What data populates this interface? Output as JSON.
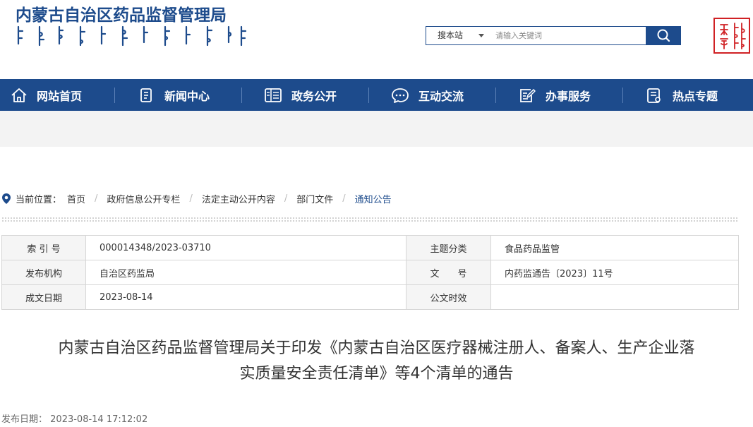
{
  "header": {
    "site_title": "内蒙古自治区药品监督管理局",
    "search": {
      "scope_label": "搜本站",
      "placeholder": "请输入关键词"
    }
  },
  "nav": {
    "items": [
      {
        "label": "网站首页",
        "icon": "home-icon"
      },
      {
        "label": "新闻中心",
        "icon": "news-icon"
      },
      {
        "label": "政务公开",
        "icon": "gov-affairs-icon"
      },
      {
        "label": "互动交流",
        "icon": "chat-icon"
      },
      {
        "label": "办事服务",
        "icon": "service-icon"
      },
      {
        "label": "热点专题",
        "icon": "topic-icon"
      }
    ]
  },
  "breadcrumb": {
    "label": "当前位置：",
    "items": [
      "首页",
      "政府信息公开专栏",
      "法定主动公开内容",
      "部门文件",
      "通知公告"
    ]
  },
  "meta": {
    "rows": [
      [
        {
          "k": "索 引 号",
          "v": "000014348/2023-03710"
        },
        {
          "k": "主题分类",
          "v": "食品药品监管"
        }
      ],
      [
        {
          "k": "发布机构",
          "v": "自治区药监局"
        },
        {
          "k": "文　　号",
          "v": "内药监通告〔2023〕11号"
        }
      ],
      [
        {
          "k": "成文日期",
          "v": "2023-08-14"
        },
        {
          "k": "公文时效",
          "v": ""
        }
      ]
    ]
  },
  "article": {
    "title_line1": "内蒙古自治区药品监督管理局关于印发《内蒙古自治区医疗器械注册人、备案人、生产企业落",
    "title_line2": "实质量安全责任清单》等4个清单的通告",
    "pubdate_label": "发布日期：",
    "pubdate_value": "2023-08-14 17:12:02"
  },
  "colors": {
    "brand_blue": "#1d4b8c",
    "seal_red": "#d02124"
  }
}
